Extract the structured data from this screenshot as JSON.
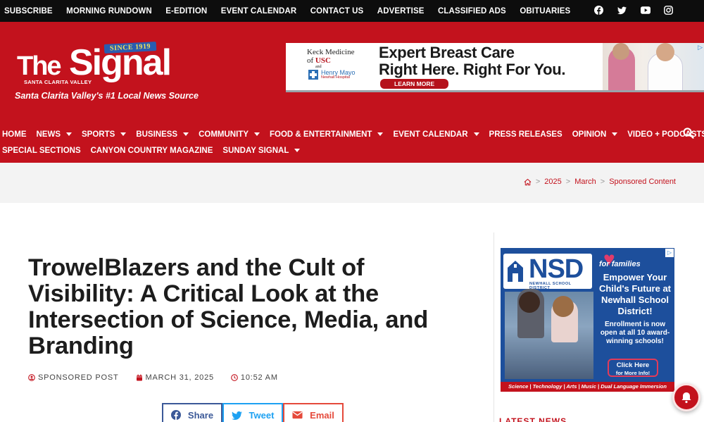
{
  "topbar": {
    "links": [
      "SUBSCRIBE",
      "MORNING RUNDOWN",
      "E-EDITION",
      "EVENT CALENDAR",
      "CONTACT US",
      "ADVERTISE",
      "CLASSIFIED ADS",
      "OBITUARIES"
    ],
    "social_icons": [
      "facebook-icon",
      "twitter-icon",
      "youtube-icon",
      "instagram-icon"
    ]
  },
  "logo": {
    "since": "SINCE 1919",
    "the": "The",
    "signal": "Signal",
    "subtitle": "SANTA CLARITA VALLEY",
    "tagline": "Santa Clarita Valley's #1 Local News Source"
  },
  "top_ad": {
    "keck_line1": "Keck Medicine",
    "keck_line2_prefix": "of ",
    "keck_line2_brand": "USC",
    "and": "and",
    "henry_mayo": "Henry Mayo",
    "henry_mayo_sub": "Newhall Hospital",
    "headline_1": "Expert Breast Care",
    "headline_2": "Right Here. Right For You.",
    "cta": "LEARN MORE"
  },
  "nav": {
    "row1": [
      {
        "label": "HOME",
        "caret": false
      },
      {
        "label": "NEWS",
        "caret": true
      },
      {
        "label": "SPORTS",
        "caret": true
      },
      {
        "label": "BUSINESS",
        "caret": true
      },
      {
        "label": "COMMUNITY",
        "caret": true
      },
      {
        "label": "FOOD & ENTERTAINMENT",
        "caret": true
      },
      {
        "label": "EVENT CALENDAR",
        "caret": true
      },
      {
        "label": "PRESS RELEASES",
        "caret": false
      },
      {
        "label": "OPINION",
        "caret": true
      },
      {
        "label": "VIDEO + PODCASTS",
        "caret": true
      }
    ],
    "row2": [
      {
        "label": "SPECIAL SECTIONS",
        "caret": false
      },
      {
        "label": "CANYON COUNTRY MAGAZINE",
        "caret": false
      },
      {
        "label": "SUNDAY SIGNAL",
        "caret": true
      }
    ]
  },
  "breadcrumb": {
    "home_icon": "home-icon",
    "items": [
      "2025",
      "March",
      "Sponsored Content"
    ],
    "separator": ">"
  },
  "article": {
    "title": "TrowelBlazers and the Cult of Visibility: A Critical Look at the Intersection of Science, Media, and Branding",
    "category": "SPONSORED POST",
    "date": "MARCH 31, 2025",
    "time": "10:52 AM",
    "share_buttons": [
      "Share",
      "Tweet",
      "Email"
    ]
  },
  "side_ad": {
    "logo": "NSD",
    "district": "NEWHALL SCHOOL DISTRICT",
    "for_families": "for families",
    "headline": "Empower Your Child's Future at Newhall School District!",
    "enrollment": "Enrollment is now open at all 10 award-winning schools!",
    "cta_line1": "Click Here",
    "cta_line2": "for More Info!",
    "strip": "Science | Technology | Arts | Music | Dual Language Immersion"
  },
  "sidebar": {
    "latest_news": "LATEST NEWS"
  },
  "colors": {
    "brand_red": "#c3121d",
    "topbar_bg": "#0d0d0d",
    "facebook": "#3b5998",
    "twitter": "#1da1f2",
    "email": "#e54a3b"
  }
}
